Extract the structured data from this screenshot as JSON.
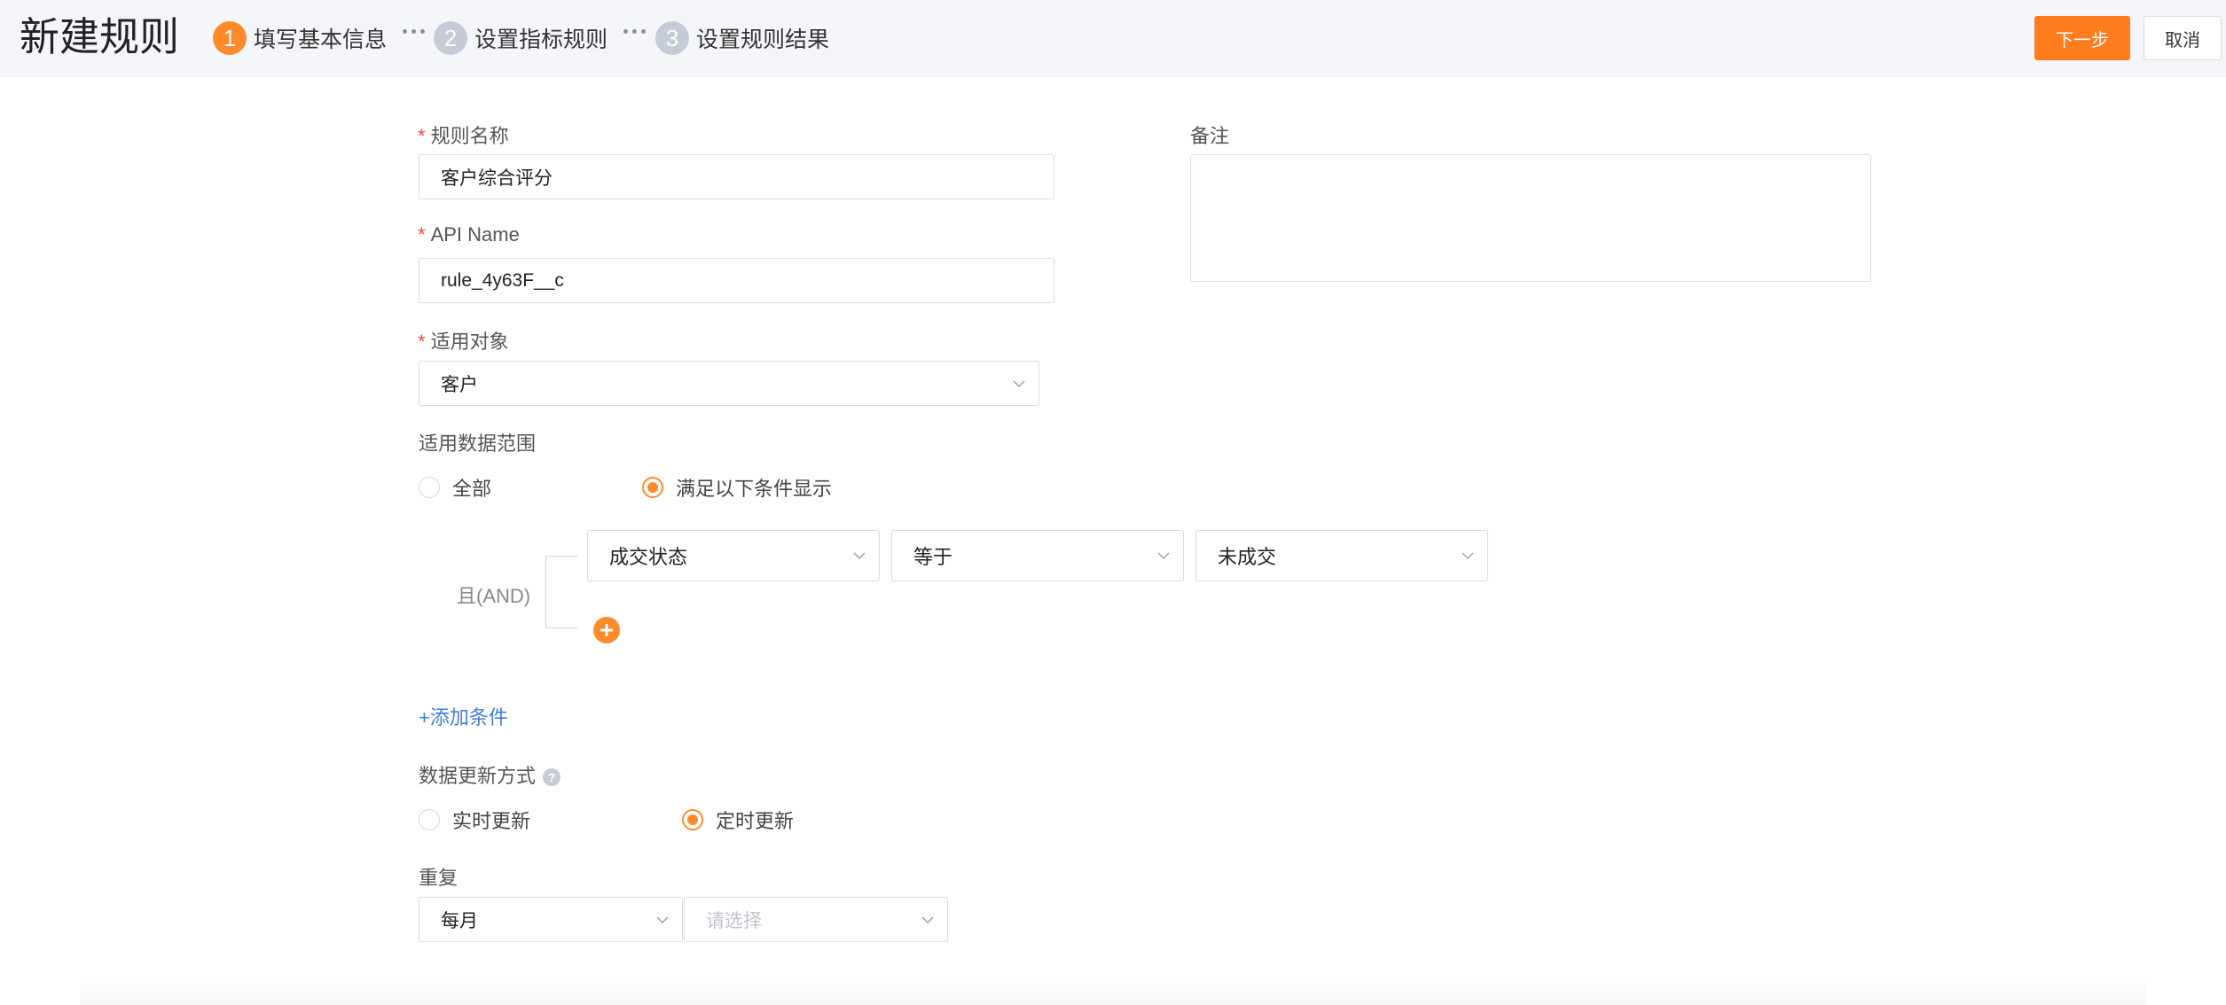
{
  "header": {
    "title": "新建规则",
    "steps": [
      {
        "num": "1",
        "label": "填写基本信息",
        "active": true
      },
      {
        "num": "2",
        "label": "设置指标规则",
        "active": false
      },
      {
        "num": "3",
        "label": "设置规则结果",
        "active": false
      }
    ],
    "next_label": "下一步",
    "cancel_label": "取消"
  },
  "form": {
    "rule_name": {
      "label": "规则名称",
      "required": "*",
      "value": "客户综合评分"
    },
    "api_name": {
      "label": "API Name",
      "required": "*",
      "value": "rule_4y63F__c"
    },
    "target": {
      "label": "适用对象",
      "required": "*",
      "value": "客户"
    },
    "remark": {
      "label": "备注",
      "value": ""
    },
    "scope": {
      "label": "适用数据范围",
      "options": [
        "全部",
        "满足以下条件显示"
      ],
      "selected": "满足以下条件显示"
    },
    "condition_group": {
      "logic": "且(AND)",
      "conditions": [
        {
          "field": "成交状态",
          "operator": "等于",
          "value": "未成交"
        }
      ]
    },
    "add_condition_label": "+添加条件",
    "update_mode": {
      "label": "数据更新方式",
      "help": "?",
      "options": [
        "实时更新",
        "定时更新"
      ],
      "selected": "定时更新"
    },
    "repeat": {
      "label": "重复",
      "frequency": "每月",
      "detail_placeholder": "请选择"
    }
  },
  "colors": {
    "accent": "#ff7d1f",
    "link": "#3f7fd6",
    "required": "#f04b3a",
    "border": "#d9dce3"
  }
}
